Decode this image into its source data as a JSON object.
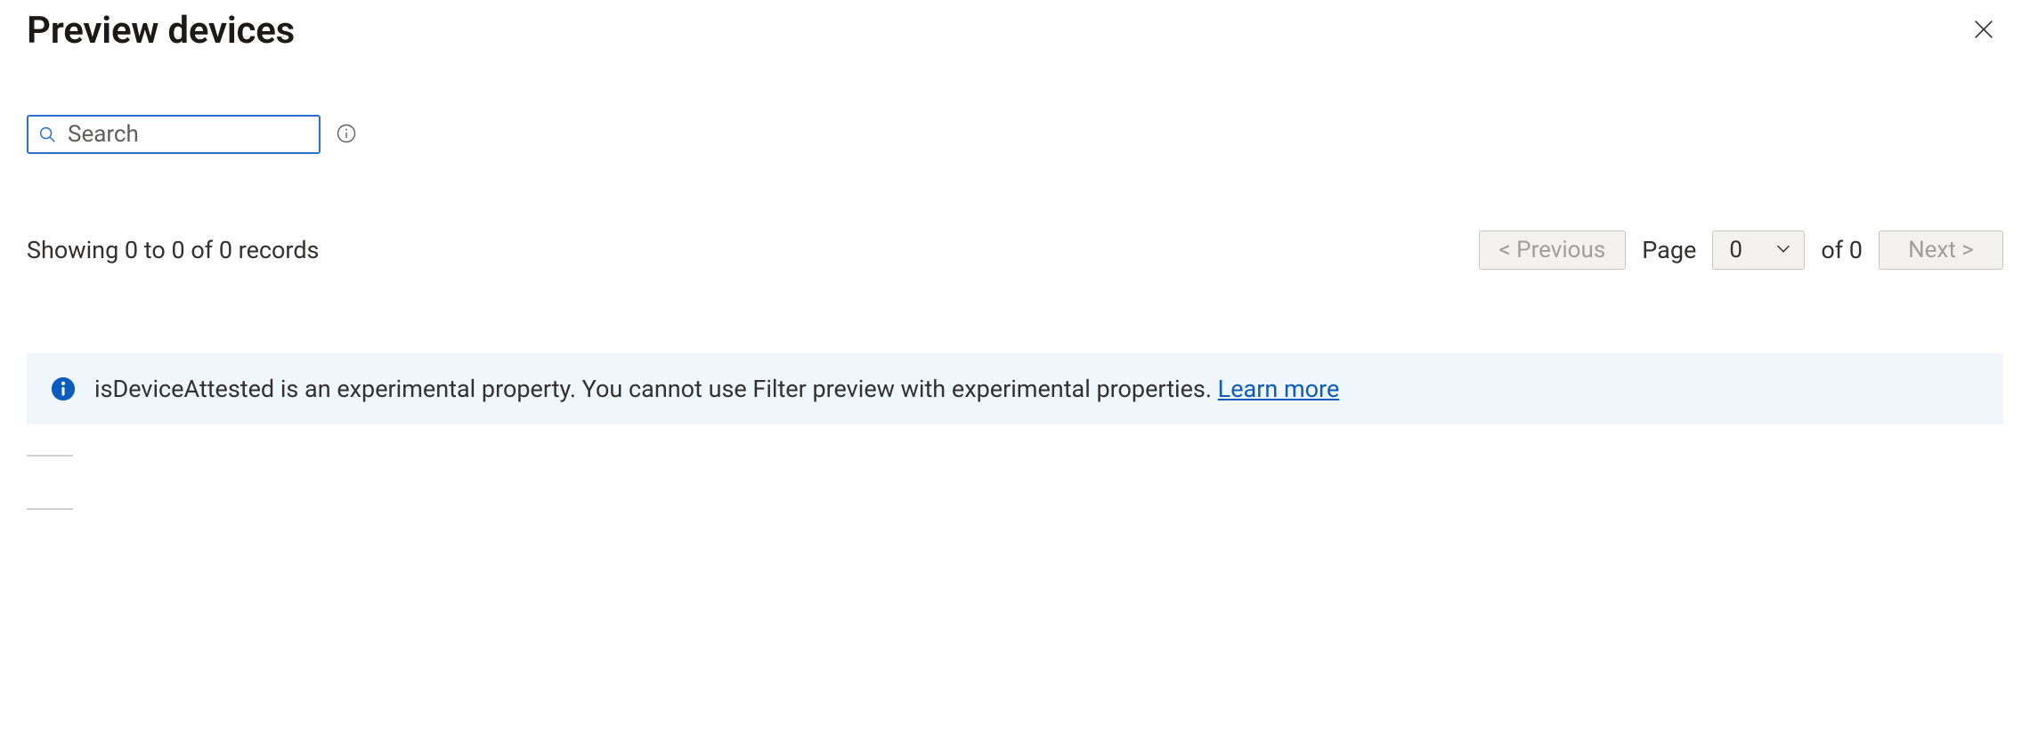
{
  "header": {
    "title": "Preview devices"
  },
  "search": {
    "placeholder": "Search",
    "value": ""
  },
  "records": {
    "summary": "Showing 0 to 0 of 0 records"
  },
  "pager": {
    "previous_label": "<  Previous",
    "next_label": "Next  >",
    "page_label": "Page",
    "of_label": "of 0",
    "page_value": "0"
  },
  "banner": {
    "text": "isDeviceAttested is an experimental property. You cannot use Filter preview with experimental properties. ",
    "link_label": "Learn more"
  }
}
